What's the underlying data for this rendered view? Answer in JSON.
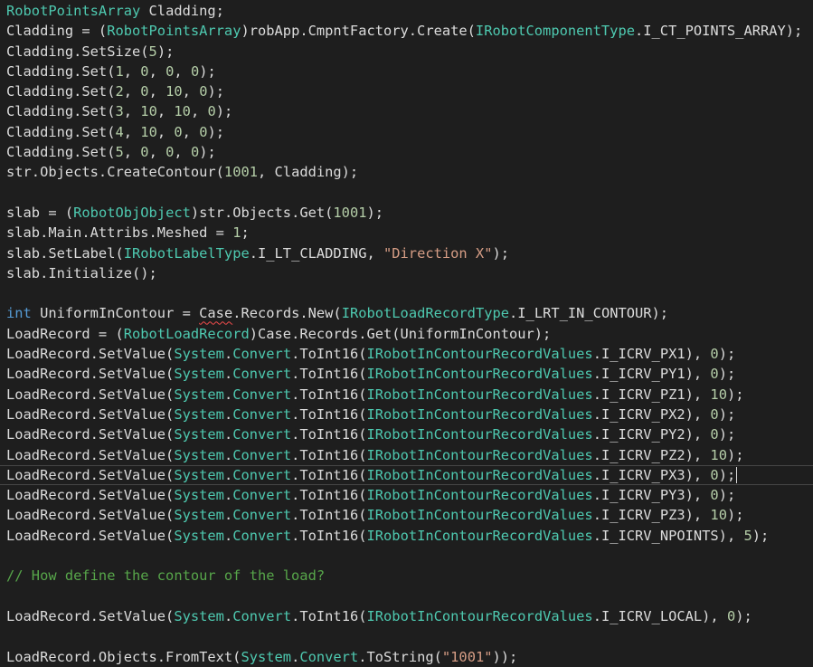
{
  "editor": {
    "colors": {
      "background": "#1e1e1e",
      "plain": "#dcdcdc",
      "type": "#4ec9b0",
      "keyword": "#569cd6",
      "number": "#b5cea8",
      "string": "#d69d85",
      "comment": "#57a64a"
    },
    "current_line_index": 23,
    "squiggle_token": "Case",
    "lines": [
      [
        [
          "type",
          "RobotPointsArray"
        ],
        [
          "plain",
          " Cladding;"
        ]
      ],
      [
        [
          "plain",
          "Cladding = ("
        ],
        [
          "type",
          "RobotPointsArray"
        ],
        [
          "plain",
          ")robApp.CmpntFactory.Create("
        ],
        [
          "type",
          "IRobotComponentType"
        ],
        [
          "plain",
          ".I_CT_POINTS_ARRAY);"
        ]
      ],
      [
        [
          "plain",
          "Cladding.SetSize("
        ],
        [
          "num",
          "5"
        ],
        [
          "plain",
          ");"
        ]
      ],
      [
        [
          "plain",
          "Cladding.Set("
        ],
        [
          "num",
          "1"
        ],
        [
          "plain",
          ", "
        ],
        [
          "num",
          "0"
        ],
        [
          "plain",
          ", "
        ],
        [
          "num",
          "0"
        ],
        [
          "plain",
          ", "
        ],
        [
          "num",
          "0"
        ],
        [
          "plain",
          ");"
        ]
      ],
      [
        [
          "plain",
          "Cladding.Set("
        ],
        [
          "num",
          "2"
        ],
        [
          "plain",
          ", "
        ],
        [
          "num",
          "0"
        ],
        [
          "plain",
          ", "
        ],
        [
          "num",
          "10"
        ],
        [
          "plain",
          ", "
        ],
        [
          "num",
          "0"
        ],
        [
          "plain",
          ");"
        ]
      ],
      [
        [
          "plain",
          "Cladding.Set("
        ],
        [
          "num",
          "3"
        ],
        [
          "plain",
          ", "
        ],
        [
          "num",
          "10"
        ],
        [
          "plain",
          ", "
        ],
        [
          "num",
          "10"
        ],
        [
          "plain",
          ", "
        ],
        [
          "num",
          "0"
        ],
        [
          "plain",
          ");"
        ]
      ],
      [
        [
          "plain",
          "Cladding.Set("
        ],
        [
          "num",
          "4"
        ],
        [
          "plain",
          ", "
        ],
        [
          "num",
          "10"
        ],
        [
          "plain",
          ", "
        ],
        [
          "num",
          "0"
        ],
        [
          "plain",
          ", "
        ],
        [
          "num",
          "0"
        ],
        [
          "plain",
          ");"
        ]
      ],
      [
        [
          "plain",
          "Cladding.Set("
        ],
        [
          "num",
          "5"
        ],
        [
          "plain",
          ", "
        ],
        [
          "num",
          "0"
        ],
        [
          "plain",
          ", "
        ],
        [
          "num",
          "0"
        ],
        [
          "plain",
          ", "
        ],
        [
          "num",
          "0"
        ],
        [
          "plain",
          ");"
        ]
      ],
      [
        [
          "plain",
          "str.Objects.CreateContour("
        ],
        [
          "num",
          "1001"
        ],
        [
          "plain",
          ", Cladding);"
        ]
      ],
      [],
      [
        [
          "plain",
          "slab = ("
        ],
        [
          "type",
          "RobotObjObject"
        ],
        [
          "plain",
          ")str.Objects.Get("
        ],
        [
          "num",
          "1001"
        ],
        [
          "plain",
          ");"
        ]
      ],
      [
        [
          "plain",
          "slab.Main.Attribs.Meshed = "
        ],
        [
          "num",
          "1"
        ],
        [
          "plain",
          ";"
        ]
      ],
      [
        [
          "plain",
          "slab.SetLabel("
        ],
        [
          "type",
          "IRobotLabelType"
        ],
        [
          "plain",
          ".I_LT_CLADDING, "
        ],
        [
          "str",
          "\"Direction X\""
        ],
        [
          "plain",
          ");"
        ]
      ],
      [
        [
          "plain",
          "slab.Initialize();"
        ]
      ],
      [],
      [
        [
          "kw",
          "int"
        ],
        [
          "plain",
          " UniformInContour = "
        ],
        [
          "squiggle",
          "Case"
        ],
        [
          "plain",
          ".Records.New("
        ],
        [
          "type",
          "IRobotLoadRecordType"
        ],
        [
          "plain",
          ".I_LRT_IN_CONTOUR);"
        ]
      ],
      [
        [
          "plain",
          "LoadRecord = ("
        ],
        [
          "type",
          "RobotLoadRecord"
        ],
        [
          "plain",
          ")Case.Records.Get(UniformInContour);"
        ]
      ],
      [
        [
          "plain",
          "LoadRecord.SetValue("
        ],
        [
          "type",
          "System"
        ],
        [
          "plain",
          "."
        ],
        [
          "type",
          "Convert"
        ],
        [
          "plain",
          ".ToInt16("
        ],
        [
          "type",
          "IRobotInContourRecordValues"
        ],
        [
          "plain",
          ".I_ICRV_PX1), "
        ],
        [
          "num",
          "0"
        ],
        [
          "plain",
          ");"
        ]
      ],
      [
        [
          "plain",
          "LoadRecord.SetValue("
        ],
        [
          "type",
          "System"
        ],
        [
          "plain",
          "."
        ],
        [
          "type",
          "Convert"
        ],
        [
          "plain",
          ".ToInt16("
        ],
        [
          "type",
          "IRobotInContourRecordValues"
        ],
        [
          "plain",
          ".I_ICRV_PY1), "
        ],
        [
          "num",
          "0"
        ],
        [
          "plain",
          ");"
        ]
      ],
      [
        [
          "plain",
          "LoadRecord.SetValue("
        ],
        [
          "type",
          "System"
        ],
        [
          "plain",
          "."
        ],
        [
          "type",
          "Convert"
        ],
        [
          "plain",
          ".ToInt16("
        ],
        [
          "type",
          "IRobotInContourRecordValues"
        ],
        [
          "plain",
          ".I_ICRV_PZ1), "
        ],
        [
          "num",
          "10"
        ],
        [
          "plain",
          ");"
        ]
      ],
      [
        [
          "plain",
          "LoadRecord.SetValue("
        ],
        [
          "type",
          "System"
        ],
        [
          "plain",
          "."
        ],
        [
          "type",
          "Convert"
        ],
        [
          "plain",
          ".ToInt16("
        ],
        [
          "type",
          "IRobotInContourRecordValues"
        ],
        [
          "plain",
          ".I_ICRV_PX2), "
        ],
        [
          "num",
          "0"
        ],
        [
          "plain",
          ");"
        ]
      ],
      [
        [
          "plain",
          "LoadRecord.SetValue("
        ],
        [
          "type",
          "System"
        ],
        [
          "plain",
          "."
        ],
        [
          "type",
          "Convert"
        ],
        [
          "plain",
          ".ToInt16("
        ],
        [
          "type",
          "IRobotInContourRecordValues"
        ],
        [
          "plain",
          ".I_ICRV_PY2), "
        ],
        [
          "num",
          "0"
        ],
        [
          "plain",
          ");"
        ]
      ],
      [
        [
          "plain",
          "LoadRecord.SetValue("
        ],
        [
          "type",
          "System"
        ],
        [
          "plain",
          "."
        ],
        [
          "type",
          "Convert"
        ],
        [
          "plain",
          ".ToInt16("
        ],
        [
          "type",
          "IRobotInContourRecordValues"
        ],
        [
          "plain",
          ".I_ICRV_PZ2), "
        ],
        [
          "num",
          "10"
        ],
        [
          "plain",
          ");"
        ]
      ],
      [
        [
          "plain",
          "LoadRecord.SetValue("
        ],
        [
          "type",
          "System"
        ],
        [
          "plain",
          "."
        ],
        [
          "type",
          "Convert"
        ],
        [
          "plain",
          ".ToInt16("
        ],
        [
          "type",
          "IRobotInContourRecordValues"
        ],
        [
          "plain",
          ".I_ICRV_PX3), "
        ],
        [
          "num",
          "0"
        ],
        [
          "plain",
          ");"
        ]
      ],
      [
        [
          "plain",
          "LoadRecord.SetValue("
        ],
        [
          "type",
          "System"
        ],
        [
          "plain",
          "."
        ],
        [
          "type",
          "Convert"
        ],
        [
          "plain",
          ".ToInt16("
        ],
        [
          "type",
          "IRobotInContourRecordValues"
        ],
        [
          "plain",
          ".I_ICRV_PY3), "
        ],
        [
          "num",
          "0"
        ],
        [
          "plain",
          ");"
        ]
      ],
      [
        [
          "plain",
          "LoadRecord.SetValue("
        ],
        [
          "type",
          "System"
        ],
        [
          "plain",
          "."
        ],
        [
          "type",
          "Convert"
        ],
        [
          "plain",
          ".ToInt16("
        ],
        [
          "type",
          "IRobotInContourRecordValues"
        ],
        [
          "plain",
          ".I_ICRV_PZ3), "
        ],
        [
          "num",
          "10"
        ],
        [
          "plain",
          ");"
        ]
      ],
      [
        [
          "plain",
          "LoadRecord.SetValue("
        ],
        [
          "type",
          "System"
        ],
        [
          "plain",
          "."
        ],
        [
          "type",
          "Convert"
        ],
        [
          "plain",
          ".ToInt16("
        ],
        [
          "type",
          "IRobotInContourRecordValues"
        ],
        [
          "plain",
          ".I_ICRV_NPOINTS), "
        ],
        [
          "num",
          "5"
        ],
        [
          "plain",
          ");"
        ]
      ],
      [],
      [
        [
          "com",
          "// How define the contour of the load?"
        ]
      ],
      [],
      [
        [
          "plain",
          "LoadRecord.SetValue("
        ],
        [
          "type",
          "System"
        ],
        [
          "plain",
          "."
        ],
        [
          "type",
          "Convert"
        ],
        [
          "plain",
          ".ToInt16("
        ],
        [
          "type",
          "IRobotInContourRecordValues"
        ],
        [
          "plain",
          ".I_ICRV_LOCAL), "
        ],
        [
          "num",
          "0"
        ],
        [
          "plain",
          ");"
        ]
      ],
      [],
      [
        [
          "plain",
          "LoadRecord.Objects.FromText("
        ],
        [
          "type",
          "System"
        ],
        [
          "plain",
          "."
        ],
        [
          "type",
          "Convert"
        ],
        [
          "plain",
          ".ToString("
        ],
        [
          "str",
          "\"1001\""
        ],
        [
          "plain",
          "));"
        ]
      ]
    ]
  }
}
